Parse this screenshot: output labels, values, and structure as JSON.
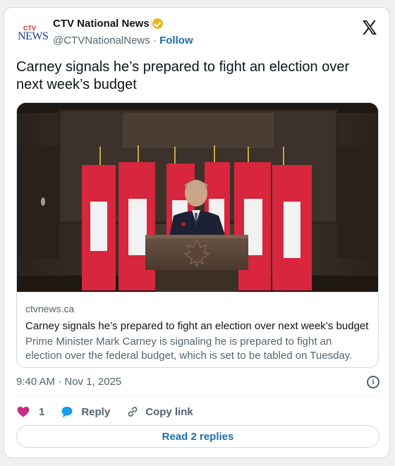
{
  "header": {
    "logo_text_top": "CTV",
    "logo_text_bottom": "NEWS",
    "display_name": "CTV National News",
    "handle": "@CTVNationalNews",
    "separator": "·",
    "follow_label": "Follow"
  },
  "tweet": {
    "text": "Carney signals he’s prepared to fight an election over next week’s budget"
  },
  "link_card": {
    "domain": "ctvnews.ca",
    "title": "Carney signals he’s prepared to fight an election over next week’s budget",
    "description": "Prime Minister Mark Carney is signaling he is prepared to fight an election over the federal budget, which is set to be tabled on Tuesday."
  },
  "meta": {
    "timestamp": "9:40 AM · Nov 1, 2025"
  },
  "actions": {
    "like_count": "1",
    "reply_label": "Reply",
    "copy_label": "Copy link"
  },
  "footer": {
    "read_replies_label": "Read 2 replies"
  },
  "colors": {
    "accent": "#1d6fa5",
    "like": "#c62d83",
    "reply": "#1d9bf0",
    "verified_badge": "#e2b719"
  },
  "icons": [
    "verified-badge-icon",
    "x-logo-icon",
    "info-icon",
    "heart-icon",
    "reply-bubble-icon",
    "link-icon"
  ]
}
